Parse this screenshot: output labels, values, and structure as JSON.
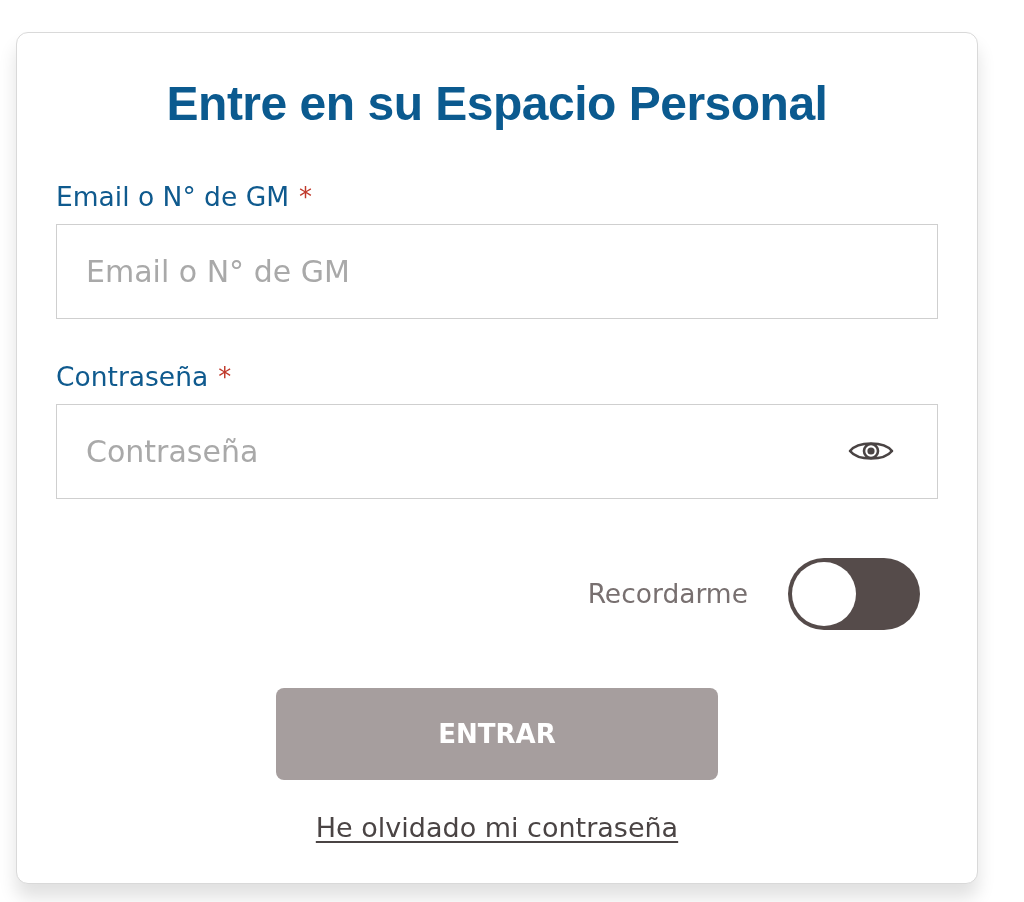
{
  "title": "Entre en su Espacio Personal",
  "fields": [
    {
      "kind": "text",
      "label": "Email o N° de GM",
      "required_mark": "*",
      "placeholder": "Email o N° de GM"
    },
    {
      "kind": "password",
      "label": "Contraseña",
      "required_mark": "*",
      "placeholder": "Contraseña"
    }
  ],
  "remember": {
    "label": "Recordarme",
    "on": false
  },
  "submit": {
    "label": "ENTRAR",
    "disabled": true
  },
  "forgot_link": "He olvidado mi contraseña"
}
